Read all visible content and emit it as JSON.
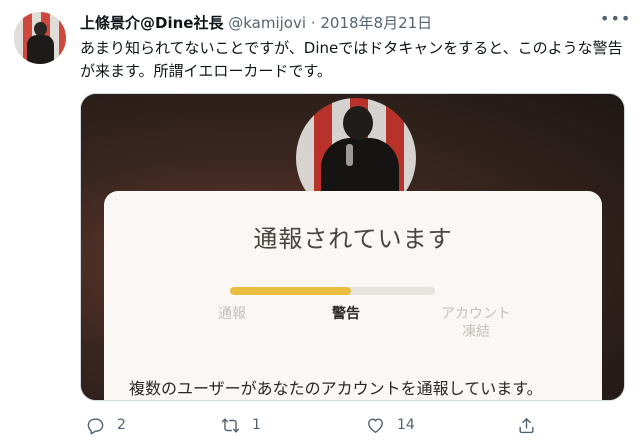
{
  "author": {
    "name": "上條景介@Dine社長",
    "handle": "@kamijovi",
    "separator": "·",
    "date": "2018年8月21日"
  },
  "tweet_text": "あまり知られてないことですが、Dineではドタキャンをすると、このような警告が来ます。所謂イエローカードです。",
  "media": {
    "dialog": {
      "title": "通報されています",
      "progress": 0.59,
      "steps": [
        {
          "label": "通報"
        },
        {
          "label": "警告"
        },
        {
          "label": "アカウント\n凍結"
        }
      ],
      "active_step": 1,
      "message": "複数のユーザーがあなたのアカウントを通報しています。"
    }
  },
  "actions": {
    "reply_count": "2",
    "retweet_count": "1",
    "like_count": "14"
  },
  "icons": {
    "more": "more-dots-icon",
    "reply": "reply-icon",
    "retweet": "retweet-icon",
    "like": "heart-icon",
    "share": "share-icon"
  },
  "colors": {
    "progress_fill": "#e9be3e",
    "progress_track": "#e7e4e0",
    "text_secondary": "#536471"
  }
}
